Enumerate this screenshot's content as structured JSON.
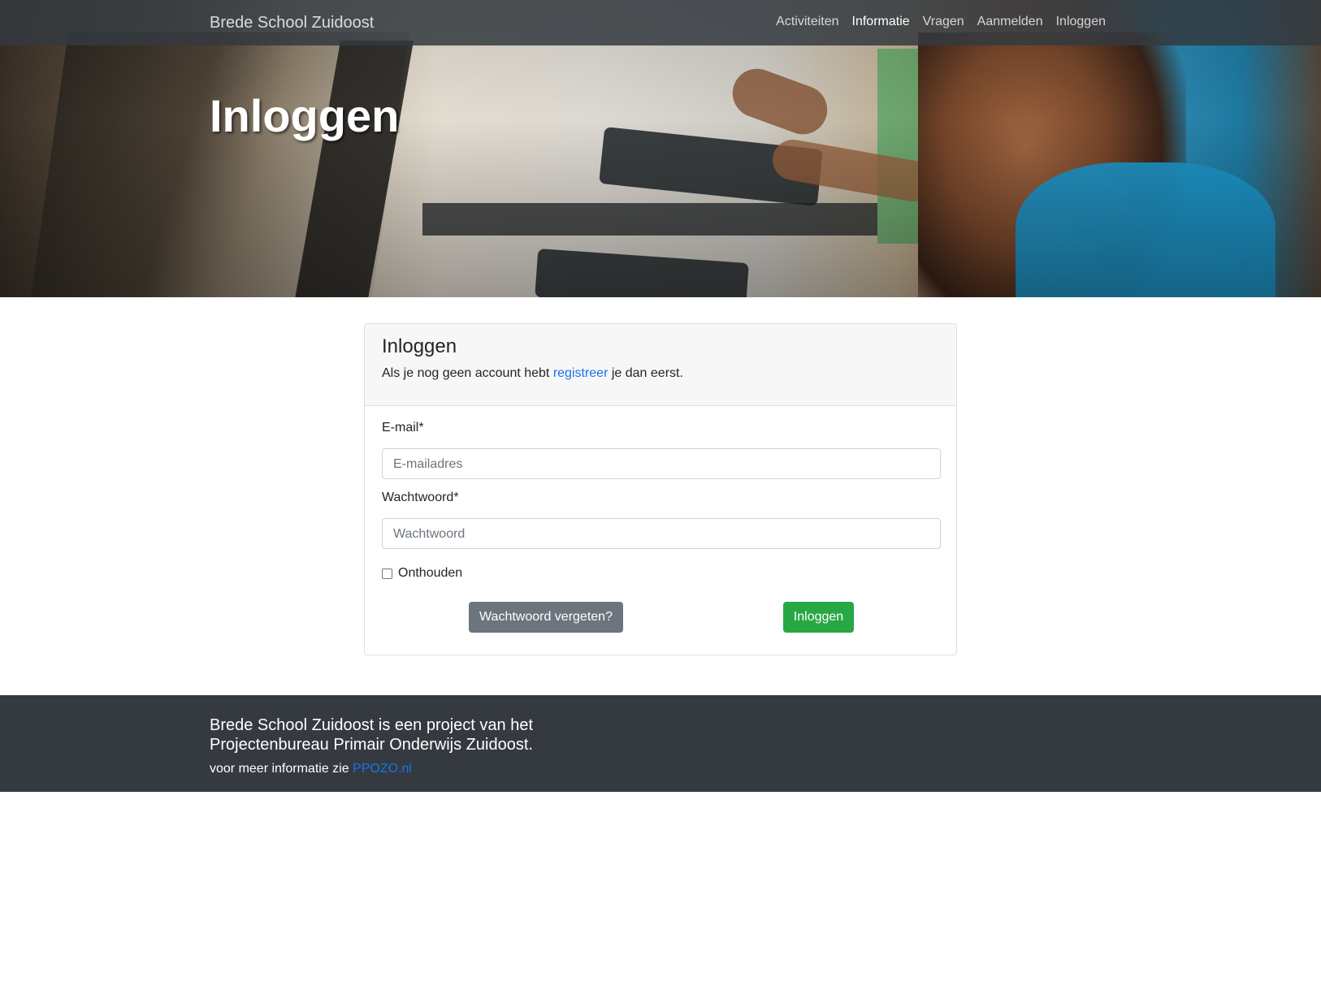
{
  "navbar": {
    "brand": "Brede School Zuidoost",
    "items": [
      {
        "label": "Activiteiten"
      },
      {
        "label": "Informatie"
      },
      {
        "label": "Vragen"
      },
      {
        "label": "Aanmelden"
      },
      {
        "label": "Inloggen"
      }
    ]
  },
  "hero": {
    "title": "Inloggen"
  },
  "login_card": {
    "title": "Inloggen",
    "subtitle_before": "Als je nog geen account hebt ",
    "register_link": "registreer",
    "subtitle_after": " je dan eerst.",
    "email_label": "E-mail*",
    "email_placeholder": "E-mailadres",
    "password_label": "Wachtwoord*",
    "password_placeholder": "Wachtwoord",
    "remember_label": "Onthouden",
    "remember_checked": false,
    "forgot_button": "Wachtwoord vergeten?",
    "login_button": "Inloggen"
  },
  "footer": {
    "text": "Brede School Zuidoost is een project van het Projectenbureau Primair Onderwijs Zuidoost.",
    "info_prefix": "voor meer informatie zie ",
    "info_link": "PPOZO.nl"
  },
  "colors": {
    "navbar_bg": "#343a40",
    "link": "#1a73e8",
    "secondary_button": "#6c757d",
    "success_button": "#28a745",
    "footer_bg": "#343a40"
  }
}
